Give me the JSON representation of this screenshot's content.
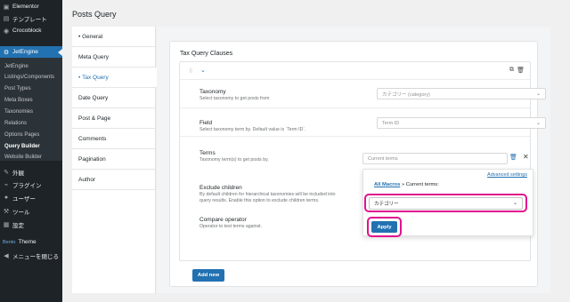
{
  "sidebar": {
    "top_items": [
      {
        "label": "Elementor",
        "icon": "elementor-icon"
      },
      {
        "label": "テンプレート",
        "icon": "folder-icon"
      },
      {
        "label": "Crocoblock",
        "icon": "crocoblock-icon"
      }
    ],
    "jetengine_label": "JetEngine",
    "sub_items": [
      "JetEngine",
      "Listings/Components",
      "Post Types",
      "Meta Boxes",
      "Taxonomies",
      "Relations",
      "Options Pages",
      "Query Builder",
      "Website Builder"
    ],
    "bottom_items": [
      {
        "label": "外観",
        "icon": "brush-icon"
      },
      {
        "label": "プラグイン",
        "icon": "plugin-icon"
      },
      {
        "label": "ユーザー",
        "icon": "user-icon"
      },
      {
        "label": "ツール",
        "icon": "wrench-icon"
      },
      {
        "label": "設定",
        "icon": "settings-icon"
      }
    ],
    "theme_prefix": "Bento",
    "theme_label": "Theme",
    "collapse_label": "メニューを閉じる"
  },
  "page": {
    "title": "Posts Query"
  },
  "tabs": [
    "General",
    "Meta Query",
    "Tax Query",
    "Date Query",
    "Post & Page",
    "Comments",
    "Pagination",
    "Author"
  ],
  "active_tab": "Tax Query",
  "card": {
    "title": "Tax Query Clauses",
    "taxonomy": {
      "label": "Taxonomy",
      "desc": "Select taxonomy to get posts from",
      "value": "カテゴリー (category)"
    },
    "field": {
      "label": "Field",
      "desc": "Select taxonomy term by. Default value is `Term ID`.",
      "value": "Term ID"
    },
    "terms": {
      "label": "Terms",
      "desc": "Taxonomy term(s) to get posts by.",
      "placeholder": "Current terms"
    },
    "exclude": {
      "label": "Exclude children",
      "desc_line1": "By default children for hierarchical taxonomies will be included into",
      "desc_line2": "query results. Enable this option to exclude children terms."
    },
    "compare": {
      "label": "Compare operator",
      "desc": "Operator to test terms against."
    },
    "add_new": "Add new"
  },
  "popover": {
    "advanced": "Advanced settings",
    "all_macros": "All Macros",
    "crumb_rest": " » Current terms:",
    "select_value": "カテゴリー",
    "apply": "Apply"
  },
  "colors": {
    "accent": "#2271b1",
    "highlight": "#e0138c",
    "sidebar": "#1d2327"
  }
}
